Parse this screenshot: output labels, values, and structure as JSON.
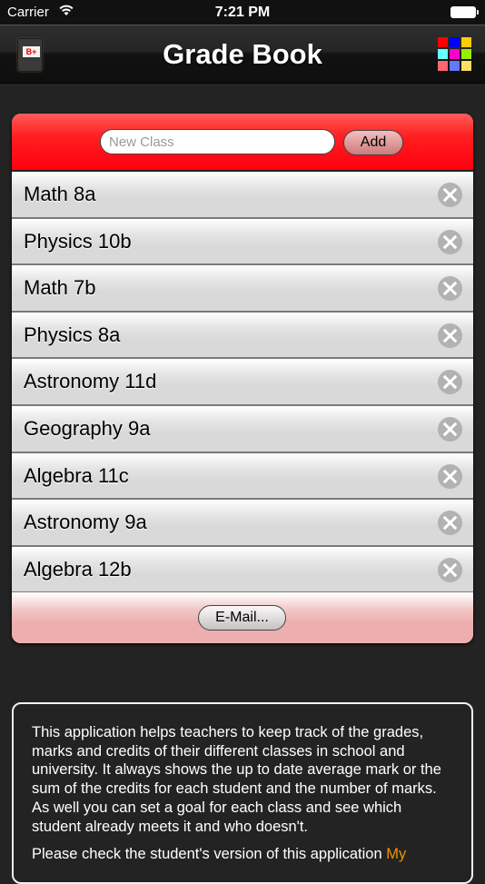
{
  "status_bar": {
    "carrier": "Carrier",
    "time": "7:21 PM",
    "wifi_icon": "wifi-icon",
    "battery_icon": "battery-icon"
  },
  "nav": {
    "title": "Grade Book",
    "left_icon": "grade-book-icon",
    "left_icon_label": "B+",
    "right_icon": "color-grid-icon",
    "grid_colors": [
      "#ff0000",
      "#0000ff",
      "#ffcc00",
      "#66ffff",
      "#ff00cc",
      "#99ee00",
      "#ff6670",
      "#6677ff",
      "#ffdd66"
    ]
  },
  "new_class": {
    "placeholder": "New Class",
    "value": "",
    "add_label": "Add"
  },
  "classes": [
    {
      "name": "Math 8a"
    },
    {
      "name": "Physics 10b"
    },
    {
      "name": "Math 7b"
    },
    {
      "name": "Physics 8a"
    },
    {
      "name": "Astronomy 11d"
    },
    {
      "name": "Geography 9a"
    },
    {
      "name": "Algebra 11c"
    },
    {
      "name": "Astronomy 9a"
    },
    {
      "name": "Algebra 12b"
    }
  ],
  "email_label": "E-Mail...",
  "info": {
    "paragraph1": "This application helps teachers to keep track of the grades, marks and credits of their different classes in school and university. It always shows the up to date average mark or the sum of the credits for each student and the number of marks. As well you can set a goal for each class and see which student already meets it and who doesn't.",
    "paragraph2_prefix": "Please check the student's version of this application ",
    "paragraph2_link": "My"
  },
  "colors": {
    "header_red": "#fe0010",
    "footer_pink": "#ecaeae",
    "link_orange": "#f0920a",
    "background": "#232323"
  }
}
